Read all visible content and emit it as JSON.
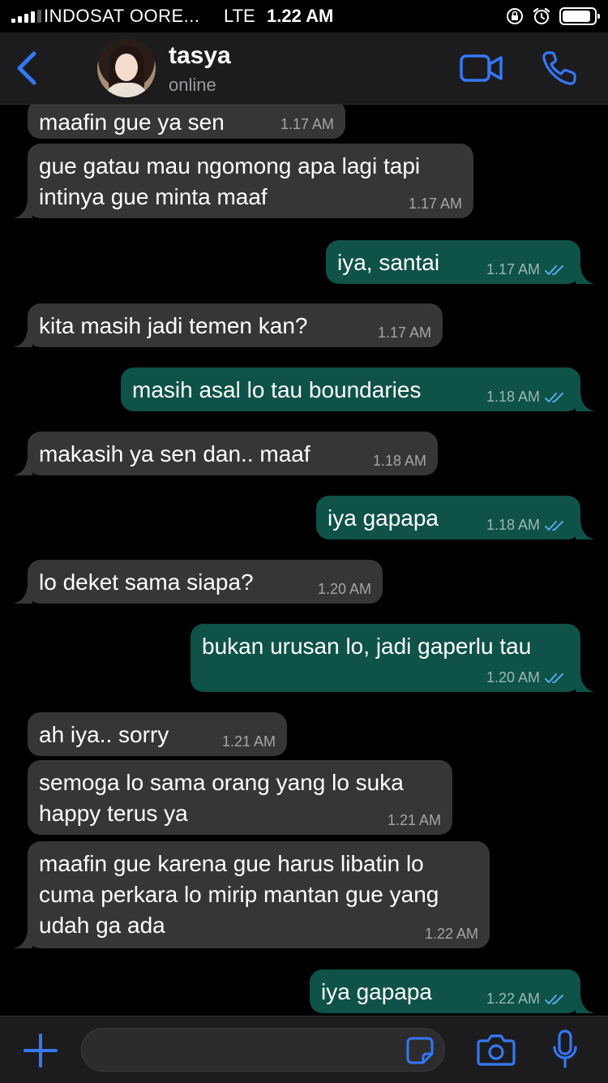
{
  "status_bar": {
    "carrier": "INDOSAT OORE...",
    "network": "LTE",
    "time": "1.22 AM"
  },
  "header": {
    "contact_name": "tasya",
    "contact_status": "online"
  },
  "colors": {
    "accent": "#3478f6",
    "bubble_incoming": "#363638",
    "bubble_outgoing": "#0e5248",
    "background": "#000000"
  },
  "messages": [
    {
      "direction": "in",
      "text": "maafin gue ya sen",
      "time": "1.17 AM"
    },
    {
      "direction": "in",
      "text": "gue gatau mau ngomong apa lagi tapi intinya gue minta maaf",
      "time": "1.17 AM"
    },
    {
      "direction": "out",
      "text": "iya, santai",
      "time": "1.17 AM",
      "read": true
    },
    {
      "direction": "in",
      "text": "kita masih jadi temen kan?",
      "time": "1.17 AM"
    },
    {
      "direction": "out",
      "text": "masih asal lo tau boundaries",
      "time": "1.18 AM",
      "read": true
    },
    {
      "direction": "in",
      "text": "makasih ya sen dan.. maaf",
      "time": "1.18 AM"
    },
    {
      "direction": "out",
      "text": "iya gapapa",
      "time": "1.18 AM",
      "read": true
    },
    {
      "direction": "in",
      "text": "lo deket sama siapa?",
      "time": "1.20 AM"
    },
    {
      "direction": "out",
      "text": "bukan urusan lo, jadi gaperlu tau",
      "time": "1.20 AM",
      "read": true
    },
    {
      "direction": "in",
      "text": "ah iya.. sorry",
      "time": "1.21 AM"
    },
    {
      "direction": "in",
      "text": "semoga lo sama orang yang lo suka happy terus ya",
      "time": "1.21 AM"
    },
    {
      "direction": "in",
      "text": "maafin gue karena gue harus libatin lo cuma perkara lo mirip mantan gue yang udah ga ada",
      "time": "1.22 AM"
    },
    {
      "direction": "out",
      "text": "iya gapapa",
      "time": "1.22 AM",
      "read": true
    }
  ],
  "input": {
    "value": "",
    "placeholder": ""
  },
  "icons": {
    "back": "chevron-left-icon",
    "video": "video-camera-icon",
    "call": "phone-icon",
    "add": "plus-icon",
    "sticker": "sticker-icon",
    "camera": "camera-icon",
    "mic": "microphone-icon"
  }
}
